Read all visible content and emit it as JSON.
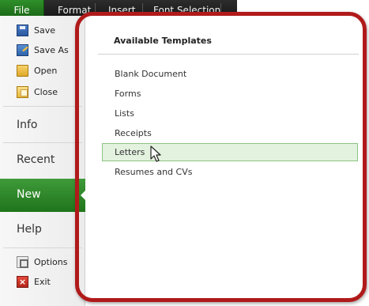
{
  "ribbon": {
    "tabs": [
      {
        "label": "File"
      },
      {
        "label": "Format"
      },
      {
        "label": "Insert"
      },
      {
        "label": "Font Selection"
      }
    ]
  },
  "backstage": {
    "commands_top": [
      {
        "label": "Save",
        "icon": "save-icon"
      },
      {
        "label": "Save As",
        "icon": "save-as-icon"
      },
      {
        "label": "Open",
        "icon": "open-folder-icon"
      },
      {
        "label": "Close",
        "icon": "close-folder-icon"
      }
    ],
    "sections": [
      {
        "label": "Info"
      },
      {
        "label": "Recent"
      },
      {
        "label": "New"
      },
      {
        "label": "Help"
      }
    ],
    "active_section": "New",
    "commands_bottom": [
      {
        "label": "Options",
        "icon": "options-icon"
      },
      {
        "label": "Exit",
        "icon": "exit-icon"
      }
    ]
  },
  "main": {
    "heading": "Available Templates",
    "templates": [
      {
        "label": "Blank Document"
      },
      {
        "label": "Forms"
      },
      {
        "label": "Lists"
      },
      {
        "label": "Receipts"
      },
      {
        "label": "Letters"
      },
      {
        "label": "Resumes and CVs"
      }
    ],
    "selected_template": "Letters"
  },
  "colors": {
    "accent_green": "#2a8a25",
    "highlight_red": "#b01a1a",
    "selection_fill": "#e3f1df"
  }
}
